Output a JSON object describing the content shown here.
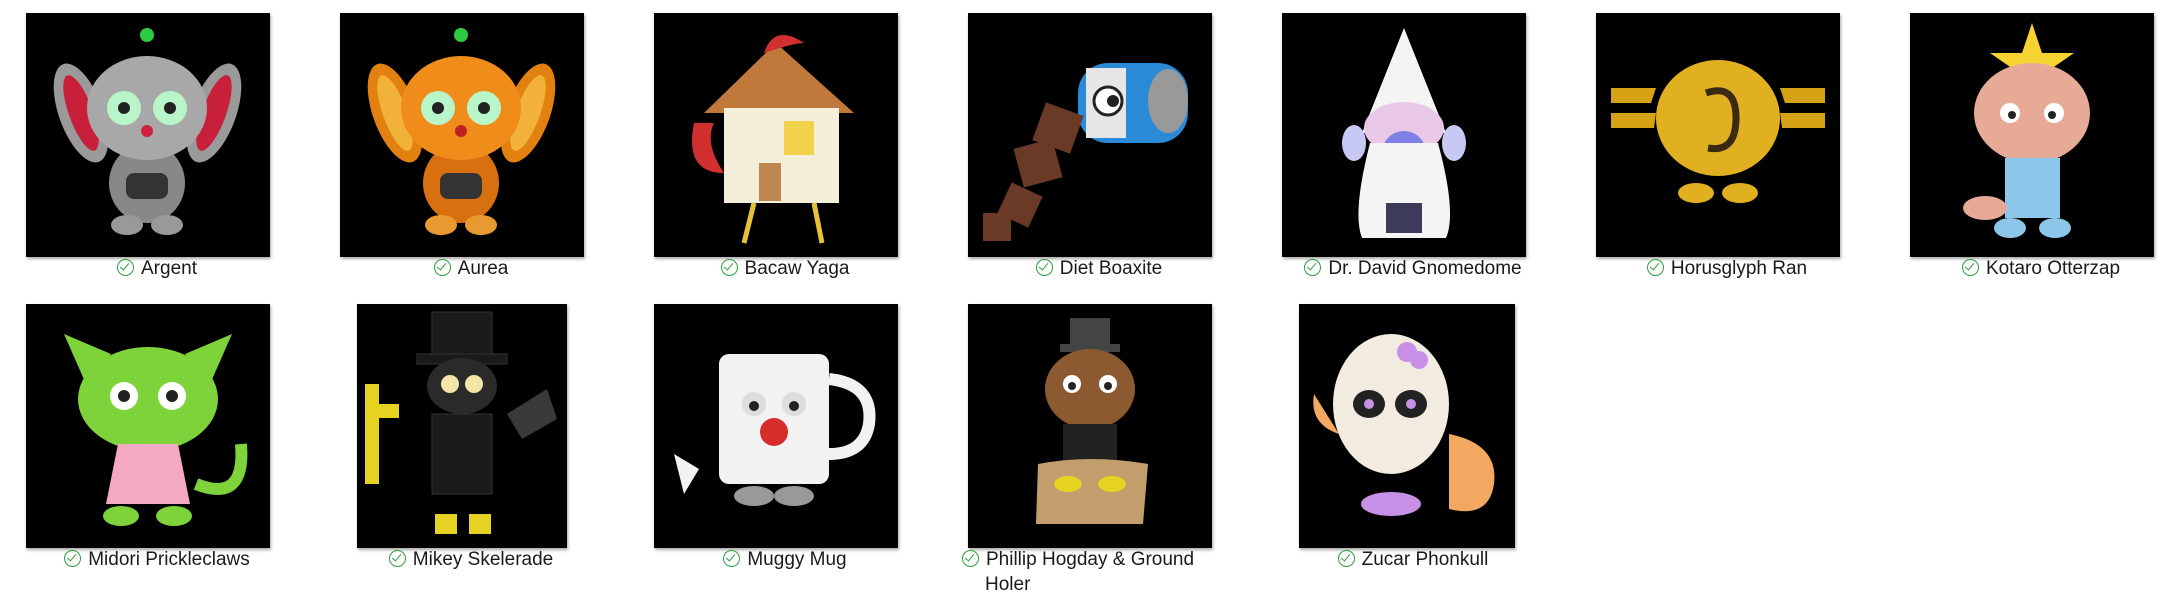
{
  "items": [
    {
      "name": "Argent"
    },
    {
      "name": "Aurea"
    },
    {
      "name": "Bacaw Yaga"
    },
    {
      "name": "Diet Boaxite"
    },
    {
      "name": "Dr. David Gnomedome"
    },
    {
      "name": "Horusglyph Ran"
    },
    {
      "name": "Kotaro Otterzap"
    },
    {
      "name": "Midori Prickleclaws"
    },
    {
      "name": "Mikey Skelerade"
    },
    {
      "name": "Muggy Mug"
    },
    {
      "name": "Phillip Hogday & Ground",
      "name_line2": "Holer"
    },
    {
      "name": "Zucar Phonkull"
    }
  ],
  "status_icon": "sync-check-icon",
  "colors": {
    "check": "#2e9e3e",
    "thumb_bg": "#000000"
  }
}
